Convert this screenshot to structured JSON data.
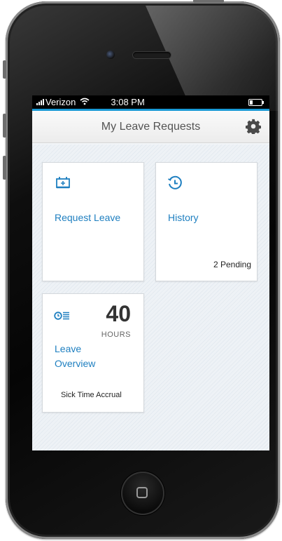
{
  "statusbar": {
    "carrier": "Verizon",
    "time": "3:08 PM",
    "wifi_icon": "wifi-icon",
    "battery_icon": "battery-icon"
  },
  "header": {
    "title": "My Leave Requests",
    "settings_icon": "gear-icon"
  },
  "tiles": {
    "request": {
      "label": "Request Leave",
      "icon": "calendar-add-icon"
    },
    "history": {
      "label": "History",
      "status": "2 Pending",
      "icon": "clock-history-icon"
    },
    "overview": {
      "label_line1": "Leave",
      "label_line2": "Overview",
      "value": "40",
      "unit": "HOURS",
      "caption": "Sick Time Accrual",
      "icon": "clock-list-icon"
    }
  },
  "colors": {
    "accent": "#1e7fc0",
    "statusbar_bg": "#000000",
    "statusbar_line": "#1a9ad6"
  }
}
